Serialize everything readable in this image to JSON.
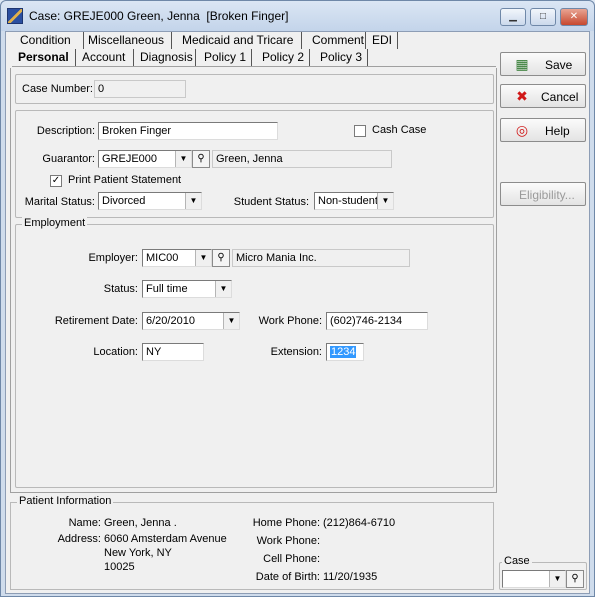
{
  "window": {
    "title": "Case: GREJE000 Green, Jenna  [Broken Finger]",
    "minimize": "▁",
    "maximize": "□",
    "close": "✕"
  },
  "tabs_row1": [
    {
      "label": "Condition",
      "accel": "C"
    },
    {
      "label": "Miscellaneous",
      "accel": "M"
    },
    {
      "label": "Medicaid and Tricare",
      "accel": "T"
    },
    {
      "label": "Comment",
      "accel": "o"
    },
    {
      "label": "EDI",
      "accel": "I"
    }
  ],
  "tabs_row2": [
    {
      "label": "Personal",
      "active": true
    },
    {
      "label": "Account"
    },
    {
      "label": "Diagnosis"
    },
    {
      "label": "Policy 1"
    },
    {
      "label": "Policy 2"
    },
    {
      "label": "Policy 3"
    }
  ],
  "case_number": {
    "label": "Case Number:",
    "value": "0"
  },
  "description": {
    "label": "Description:",
    "value": "Broken Finger"
  },
  "cash_case": {
    "label": "Cash Case",
    "checked": false
  },
  "guarantor": {
    "label": "Guarantor:",
    "value": "GREJE000",
    "name": "Green, Jenna"
  },
  "print_statement": {
    "label": "Print Patient Statement",
    "checked": true
  },
  "marital_status": {
    "label": "Marital Status:",
    "value": "Divorced"
  },
  "student_status": {
    "label": "Student Status:",
    "value": "Non-student"
  },
  "employment": {
    "title": "Employment",
    "employer": {
      "label": "Employer:",
      "value": "MIC00",
      "name": "Micro Mania Inc."
    },
    "status": {
      "label": "Status:",
      "value": "Full time"
    },
    "retirement_date": {
      "label": "Retirement Date:",
      "value": "6/20/2010"
    },
    "work_phone": {
      "label": "Work Phone:",
      "value": "(602)746-2134"
    },
    "location": {
      "label": "Location:",
      "value": "NY"
    },
    "extension": {
      "label": "Extension:",
      "value": "1234"
    }
  },
  "side_buttons": {
    "save": "Save",
    "cancel": "Cancel",
    "help": "Help",
    "eligibility": "Eligibility..."
  },
  "patient_info": {
    "title": "Patient Information",
    "name_label": "Name:",
    "name": "Green, Jenna .",
    "address_label": "Address:",
    "address_line1": "6060 Amsterdam Avenue",
    "address_line2": "New York, NY",
    "address_line3": "10025",
    "home_phone_label": "Home Phone:",
    "home_phone": "(212)864-6710",
    "work_phone_label": "Work Phone:",
    "work_phone": "",
    "cell_phone_label": "Cell Phone:",
    "cell_phone": "",
    "dob_label": "Date of Birth:",
    "dob": "11/20/1935"
  },
  "case_selector": {
    "label": "Case",
    "value": ""
  }
}
